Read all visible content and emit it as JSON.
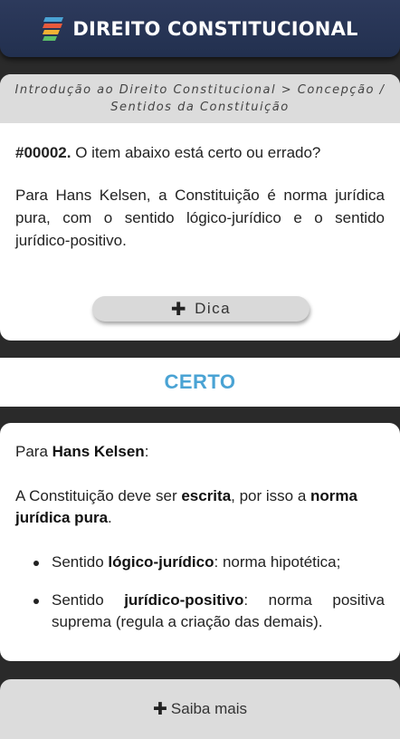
{
  "header": {
    "title": "DIREITO CONSTITUCIONAL",
    "logo_icon": "stacked-stripes-logo-icon"
  },
  "breadcrumb": "Introdução ao Direito Constitucional > Concepção / Sentidos da Constituição",
  "question": {
    "number": "#00002.",
    "prompt": "O item abaixo está certo ou errado?",
    "statement": "Para Hans Kelsen, a Constituição é norma jurídica pura, com o sentido lógico-jurídico e o sentido jurídico-positivo."
  },
  "dica_button": {
    "icon": "plus-icon",
    "label": "Dica"
  },
  "answer": {
    "label": "CERTO",
    "color": "#4aa3d4"
  },
  "explanation": {
    "p1_prefix": "Para ",
    "p1_bold": "Hans Kelsen",
    "p1_suffix": ":",
    "p2_a": "A Constituição deve ser ",
    "p2_b": "escrita",
    "p2_c": ", por isso a ",
    "p2_d": "norma jurídica pura",
    "p2_e": ".",
    "bullets": [
      {
        "prefix": "Sentido ",
        "bold": "lógico-jurídico",
        "suffix": ": norma hipotética;"
      },
      {
        "prefix": "Sentido ",
        "bold": "jurídico-positivo",
        "suffix": ": norma positiva suprema (regula a criação das demais)."
      }
    ]
  },
  "saiba_button": {
    "icon": "plus-icon",
    "label": "Saiba mais"
  }
}
